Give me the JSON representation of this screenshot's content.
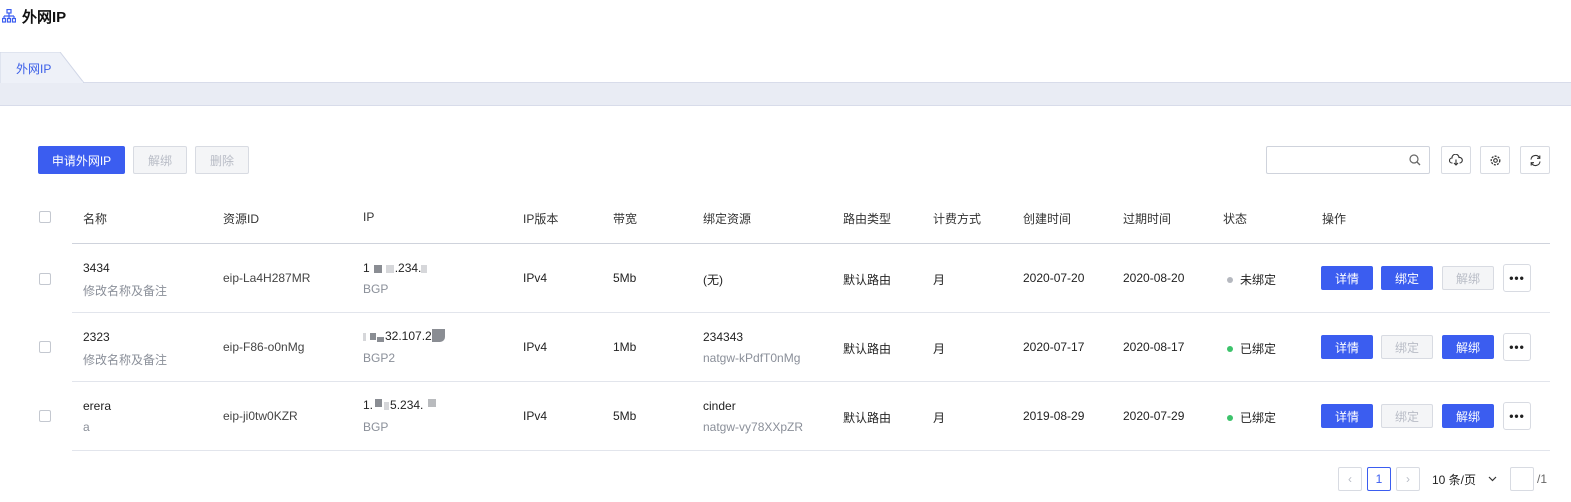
{
  "header": {
    "title": "外网IP",
    "icon": "sitemap-icon"
  },
  "tabs": [
    {
      "label": "外网IP",
      "active": true
    }
  ],
  "toolbar": {
    "apply_label": "申请外网IP",
    "unbind_label": "解绑",
    "delete_label": "删除",
    "search_placeholder": "",
    "search_value": ""
  },
  "columns": [
    "名称",
    "资源ID",
    "IP",
    "IP版本",
    "带宽",
    "绑定资源",
    "路由类型",
    "计费方式",
    "创建时间",
    "过期时间",
    "状态",
    "操作"
  ],
  "rows": [
    {
      "name": "3434",
      "remark": "修改名称及备注",
      "resource_id": "eip-La4H287MR",
      "ip_a": "1",
      "ip_b": ".234.",
      "ip_line": "BGP",
      "version": "IPv4",
      "bandwidth": "5Mb",
      "bound": "(无)",
      "bound_sub": "",
      "route": "默认路由",
      "billing": "月",
      "created": "2020-07-20",
      "expires": "2020-08-20",
      "status": "未绑定",
      "status_color": "#b5b8bf",
      "detail_label": "详情",
      "bind_label": "绑定",
      "unbind_label": "解绑",
      "bind_enabled": true,
      "unbind_enabled": false
    },
    {
      "name": "2323",
      "remark": "修改名称及备注",
      "resource_id": "eip-F86-o0nMg",
      "ip_a": "",
      "ip_b": "32.107.2",
      "ip_line": "BGP2",
      "version": "IPv4",
      "bandwidth": "1Mb",
      "bound": "234343",
      "bound_sub": "natgw-kPdfT0nMg",
      "route": "默认路由",
      "billing": "月",
      "created": "2020-07-17",
      "expires": "2020-08-17",
      "status": "已绑定",
      "status_color": "#3cc36b",
      "detail_label": "详情",
      "bind_label": "绑定",
      "unbind_label": "解绑",
      "bind_enabled": false,
      "unbind_enabled": true
    },
    {
      "name": "erera",
      "remark": "a",
      "resource_id": "eip-ji0tw0KZR",
      "ip_a": "1.",
      "ip_b": "5.234.",
      "ip_line": "BGP",
      "version": "IPv4",
      "bandwidth": "5Mb",
      "bound": "cinder",
      "bound_sub": "natgw-vy78XXpZR",
      "route": "默认路由",
      "billing": "月",
      "created": "2019-08-29",
      "expires": "2020-07-29",
      "status": "已绑定",
      "status_color": "#3cc36b",
      "detail_label": "详情",
      "bind_label": "绑定",
      "unbind_label": "解绑",
      "bind_enabled": false,
      "unbind_enabled": true
    }
  ],
  "pagination": {
    "current_page": "1",
    "page_size_label": "10 条/页",
    "total_pages": "/1",
    "jump_value": ""
  },
  "colors": {
    "primary": "#3b5df0",
    "tab_text": "#3a5ee8",
    "bound_green": "#3cc36b",
    "unbound_gray": "#b5b8bf"
  }
}
